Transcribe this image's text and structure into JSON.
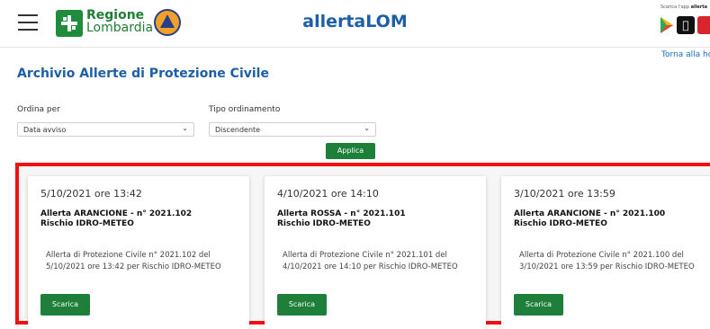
{
  "header": {
    "logo_line1": "Regione",
    "logo_line2": "Lombardia",
    "app_title": "allertaLOM",
    "store_prefix": "Scarica l'app",
    "store_app": "allerta"
  },
  "home_link": "Torna alla ho",
  "page_title": "Archivio Allerte di Protezione Civile",
  "filters": {
    "sort_by_label": "Ordina per",
    "sort_by_value": "Data avviso",
    "sort_type_label": "Tipo ordinamento",
    "sort_type_value": "Discendente",
    "apply_label": "Applica"
  },
  "cards": [
    {
      "date": "5/10/2021 ore 13:42",
      "title_line1": "Allerta ARANCIONE - n° 2021.102",
      "title_line2": "Rischio IDRO-METEO",
      "description": "Allerta di Protezione Civile n° 2021.102 del 5/10/2021 ore 13:42 per Rischio IDRO-METEO",
      "button": "Scarica"
    },
    {
      "date": "4/10/2021 ore 14:10",
      "title_line1": "Allerta ROSSA - n° 2021.101",
      "title_line2": "Rischio IDRO-METEO",
      "description": "Allerta di Protezione Civile n° 2021.101 del 4/10/2021 ore 14:10 per Rischio IDRO-METEO",
      "button": "Scarica"
    },
    {
      "date": "3/10/2021 ore 13:59",
      "title_line1": "Allerta ARANCIONE - n° 2021.100",
      "title_line2": "Rischio IDRO-METEO",
      "description": "Allerta di Protezione Civile n° 2021.100 del 3/10/2021 ore 13:59 per Rischio IDRO-METEO",
      "button": "Scarica"
    }
  ],
  "colors": {
    "brand_green": "#1d7f3a",
    "title_blue": "#1c5fa8",
    "highlight_red": "#f21010"
  }
}
